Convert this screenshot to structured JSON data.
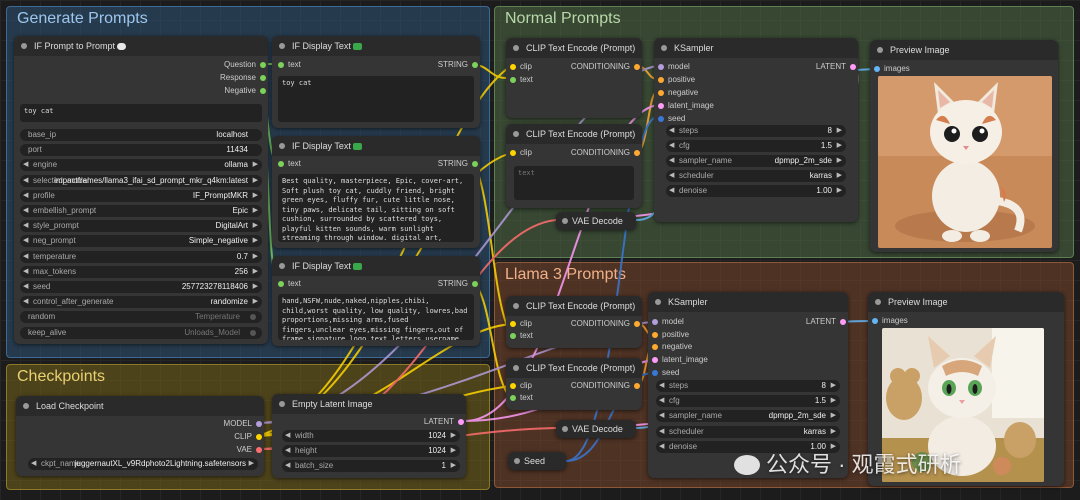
{
  "groups": {
    "generate": "Generate Prompts",
    "normal": "Normal Prompts",
    "llama": "Llama 3 Prompts",
    "checkpoints": "Checkpoints"
  },
  "if_prompt": {
    "title": "IF Prompt to Prompt",
    "outputs": [
      "Question",
      "Response",
      "Negative"
    ],
    "input_text": "toy cat",
    "widgets": [
      {
        "label": "base_ip",
        "value": "localhost"
      },
      {
        "label": "port",
        "value": "11434"
      },
      {
        "label": "engine",
        "value": "ollama"
      },
      {
        "label": "selected_model",
        "value": "impactframes/llama3_ifai_sd_prompt_mkr_q4km:latest"
      },
      {
        "label": "profile",
        "value": "IF_PromptMKR"
      },
      {
        "label": "embellish_prompt",
        "value": "Epic"
      },
      {
        "label": "style_prompt",
        "value": "DigitalArt"
      },
      {
        "label": "neg_prompt",
        "value": "Simple_negative"
      },
      {
        "label": "temperature",
        "value": "0.7"
      },
      {
        "label": "max_tokens",
        "value": "256"
      },
      {
        "label": "seed",
        "value": "257723278118406"
      },
      {
        "label": "control_after_generate",
        "value": "randomize"
      },
      {
        "label": "random",
        "value": "Temperature"
      },
      {
        "label": "keep_alive",
        "value": "Unloads_Model"
      }
    ]
  },
  "display1": {
    "title": "IF Display Text",
    "input": "text",
    "output": "STRING",
    "content": "toy cat"
  },
  "display2": {
    "title": "IF Display Text",
    "input": "text",
    "output": "STRING",
    "content": "Best quality, masterpiece, Epic, cover-art, Soft plush toy cat, cuddly friend, bright green eyes, fluffy fur, cute little nose, tiny paws, delicate tail, sitting on soft cushion, surrounded by scattered toys, playful kitten sounds, warm sunlight streaming through window. digital art, vector graphics, flat stylized design"
  },
  "display3": {
    "title": "IF Display Text",
    "input": "text",
    "output": "STRING",
    "content": "hand,NSFW,nude,naked,nipples,chibi, child,worst quality, low quality, lowres,bad proportions,missing arms,fused fingers,unclear eyes,missing fingers,out of frame,signature,logo,text,letters,username"
  },
  "clip_n1": {
    "title": "CLIP Text Encode (Prompt)",
    "in_clip": "clip",
    "in_text": "text",
    "out": "CONDITIONING"
  },
  "clip_n2": {
    "title": "CLIP Text Encode (Prompt)",
    "in_clip": "clip",
    "out": "CONDITIONING",
    "placeholder": "text"
  },
  "ksampler_n": {
    "title": "KSampler",
    "inputs": [
      "model",
      "positive",
      "negative",
      "latent_image",
      "seed"
    ],
    "output": "LATENT",
    "widgets": [
      {
        "label": "steps",
        "value": "8"
      },
      {
        "label": "cfg",
        "value": "1.5"
      },
      {
        "label": "sampler_name",
        "value": "dpmpp_2m_sde"
      },
      {
        "label": "scheduler",
        "value": "karras"
      },
      {
        "label": "denoise",
        "value": "1.00"
      }
    ]
  },
  "preview_n": {
    "title": "Preview Image",
    "input": "images"
  },
  "vae_n": {
    "title": "VAE Decode"
  },
  "clip_l1": {
    "title": "CLIP Text Encode (Prompt)",
    "in_clip": "clip",
    "in_text": "text",
    "out": "CONDITIONING"
  },
  "clip_l2": {
    "title": "CLIP Text Encode (Prompt)",
    "in_clip": "clip",
    "in_text": "text",
    "out": "CONDITIONING"
  },
  "ksampler_l": {
    "title": "KSampler",
    "inputs": [
      "model",
      "positive",
      "negative",
      "latent_image",
      "seed"
    ],
    "output": "LATENT",
    "widgets": [
      {
        "label": "steps",
        "value": "8"
      },
      {
        "label": "cfg",
        "value": "1.5"
      },
      {
        "label": "sampler_name",
        "value": "dpmpp_2m_sde"
      },
      {
        "label": "scheduler",
        "value": "karras"
      },
      {
        "label": "denoise",
        "value": "1.00"
      }
    ]
  },
  "preview_l": {
    "title": "Preview Image",
    "input": "images"
  },
  "vae_l": {
    "title": "VAE Decode"
  },
  "seed_node": {
    "title": "Seed"
  },
  "checkpoint": {
    "title": "Load Checkpoint",
    "outputs": [
      "MODEL",
      "CLIP",
      "VAE"
    ],
    "ckpt_label": "ckpt_name",
    "ckpt_value": "juggernautXL_v9Rdphoto2Lightning.safetensors"
  },
  "latent": {
    "title": "Empty Latent Image",
    "output": "LATENT",
    "widgets": [
      {
        "label": "width",
        "value": "1024"
      },
      {
        "label": "height",
        "value": "1024"
      },
      {
        "label": "batch_size",
        "value": "1"
      }
    ]
  },
  "watermark": {
    "text": "公众号 · 观霞式研析",
    "icon": "wechat-icon"
  },
  "colors": {
    "clip": "#ffd500",
    "conditioning": "#ffa931",
    "latent": "#ff9cf9",
    "model": "#b39ddb",
    "image": "#64b5f6",
    "string": "#7cd25b",
    "vae": "#ff6e6e"
  }
}
